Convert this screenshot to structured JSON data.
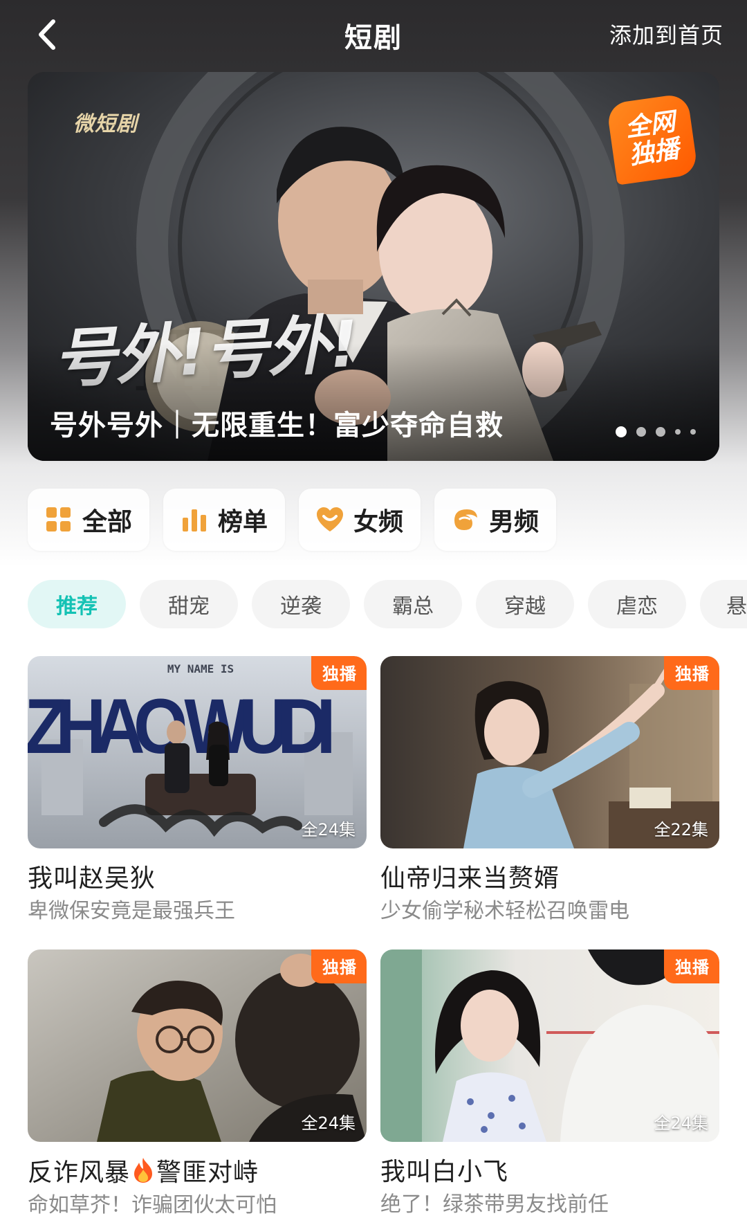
{
  "header": {
    "title": "短剧",
    "add_home_label": "添加到首页"
  },
  "banner": {
    "brand": "微短剧",
    "badge_line1": "全网",
    "badge_line2": "独播",
    "art_title": "号外!号外!",
    "caption": "号外号外｜无限重生！富少夺命自救",
    "dots_total": 5,
    "active_dot": 1
  },
  "categories": [
    {
      "label": "全部",
      "icon": "grid-icon"
    },
    {
      "label": "榜单",
      "icon": "chart-bars-icon"
    },
    {
      "label": "女频",
      "icon": "heart-icon"
    },
    {
      "label": "男频",
      "icon": "swirl-icon"
    }
  ],
  "tags": [
    "推荐",
    "甜宠",
    "逆袭",
    "霸总",
    "穿越",
    "虐恋",
    "悬"
  ],
  "active_tag": "推荐",
  "dramas": [
    {
      "badge": "独播",
      "poster_text_top": "MY NAME IS",
      "poster_text_main": "ZHAO WUDI",
      "episodes": "全24集",
      "title": "我叫赵吴狄",
      "subtitle": "卑微保安竟是最强兵王"
    },
    {
      "badge": "独播",
      "episodes": "全22集",
      "title": "仙帝归来当赘婿",
      "subtitle": "少女偷学秘术轻松召唤雷电"
    },
    {
      "badge": "独播",
      "episodes": "全24集",
      "title_a": "反诈风暴",
      "title_b": "警匪对峙",
      "subtitle": "命如草芥！诈骗团伙太可怕"
    },
    {
      "badge": "独播",
      "episodes": "全24集",
      "title": "我叫白小飞",
      "subtitle": "绝了！绿茶带男友找前任"
    }
  ],
  "colors": {
    "accent_teal": "#14c2b4",
    "exclusive_orange": "#ff6a1a",
    "category_icon_orange": "#f0a23a"
  }
}
